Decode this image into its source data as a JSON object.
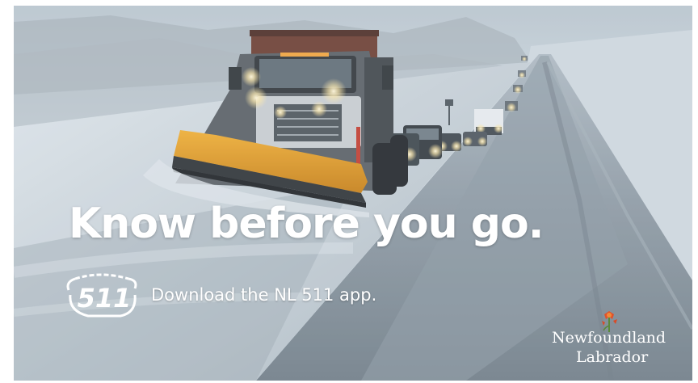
{
  "ad": {
    "headline": "Know before you go.",
    "app_prompt": "Download the NL 511 app.",
    "badge_text": "511",
    "province_line1": "Newfoundland",
    "province_line2": "Labrador"
  },
  "colors": {
    "text": "#ffffff",
    "plow_blade": "#e59a1e",
    "snow_sky": "#c9d3da",
    "road": "#7d8a94",
    "flower": "#e0522b"
  },
  "icons": [
    "511-logo-icon",
    "pitcher-plant-icon"
  ]
}
